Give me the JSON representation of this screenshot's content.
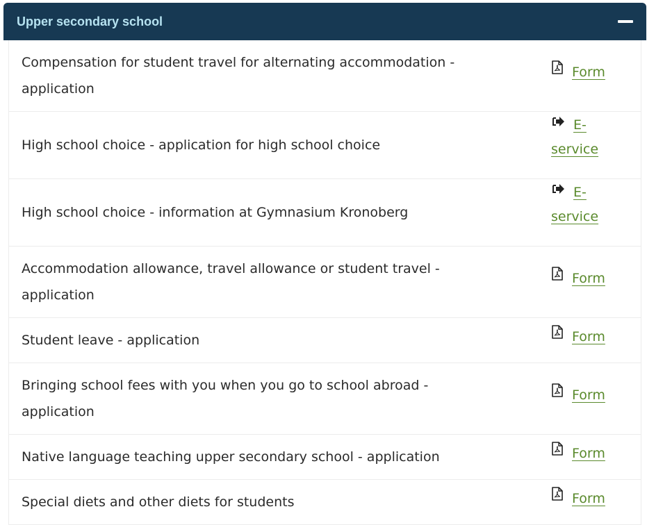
{
  "accordion": {
    "title": "Upper secondary school",
    "expanded": true
  },
  "rows": [
    {
      "label_lines": [
        "Compensation for student travel for alternating accommodation -",
        "application"
      ],
      "action_icon": "pdf-icon",
      "action_lines": [
        "Form"
      ]
    },
    {
      "label_lines": [
        "High school choice - application for high school choice"
      ],
      "action_icon": "arrow-right-icon",
      "action_lines": [
        "E-",
        "service"
      ]
    },
    {
      "label_lines": [
        "High school choice - information at Gymnasium Kronoberg"
      ],
      "action_icon": "arrow-right-icon",
      "action_lines": [
        "E-",
        "service"
      ]
    },
    {
      "label_lines": [
        "Accommodation allowance, travel allowance or student travel -",
        "application"
      ],
      "action_icon": "pdf-icon",
      "action_lines": [
        "Form"
      ]
    },
    {
      "label_lines": [
        "Student leave - application"
      ],
      "action_icon": "pdf-icon",
      "action_lines": [
        "Form"
      ]
    },
    {
      "label_lines": [
        "Bringing school fees with you when you go to school abroad -",
        "application"
      ],
      "action_icon": "pdf-icon",
      "action_lines": [
        "Form"
      ]
    },
    {
      "label_lines": [
        "Native language teaching upper secondary school - application"
      ],
      "action_icon": "pdf-icon",
      "action_lines": [
        "Form"
      ]
    },
    {
      "label_lines": [
        "Special diets and other diets for students"
      ],
      "action_icon": "pdf-icon",
      "action_lines": [
        "Form"
      ]
    }
  ],
  "colors": {
    "header_bg": "#173953",
    "header_text": "#b6e2f0",
    "link": "#5a8a2c",
    "border": "#ececec"
  }
}
